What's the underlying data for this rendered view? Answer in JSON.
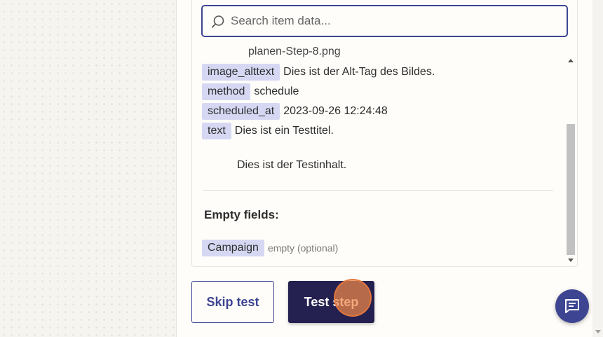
{
  "search": {
    "placeholder": "Search item data..."
  },
  "list": {
    "cut_off_text": "planen-Step-8.png",
    "fields": [
      {
        "key": "image_alttext",
        "value": "Dies ist der Alt-Tag des Bildes."
      },
      {
        "key": "method",
        "value": "schedule"
      },
      {
        "key": "scheduled_at",
        "value": "2023-09-26 12:24:48"
      },
      {
        "key": "text",
        "value": "Dies ist ein Testtitel.",
        "value_line2": "Dies ist der Testinhalt."
      }
    ],
    "empty_section_title": "Empty fields:",
    "empty_fields": [
      {
        "key": "Campaign",
        "value": "empty (optional)"
      }
    ]
  },
  "actions": {
    "skip_label": "Skip test",
    "test_label": "Test step"
  },
  "icons": {
    "search": "search-icon",
    "chat": "chat-icon"
  },
  "colors": {
    "accent": "#3d4592",
    "primary_button": "#24204f",
    "tag_background": "#d6d8f3",
    "click_marker": "#ee8748"
  }
}
